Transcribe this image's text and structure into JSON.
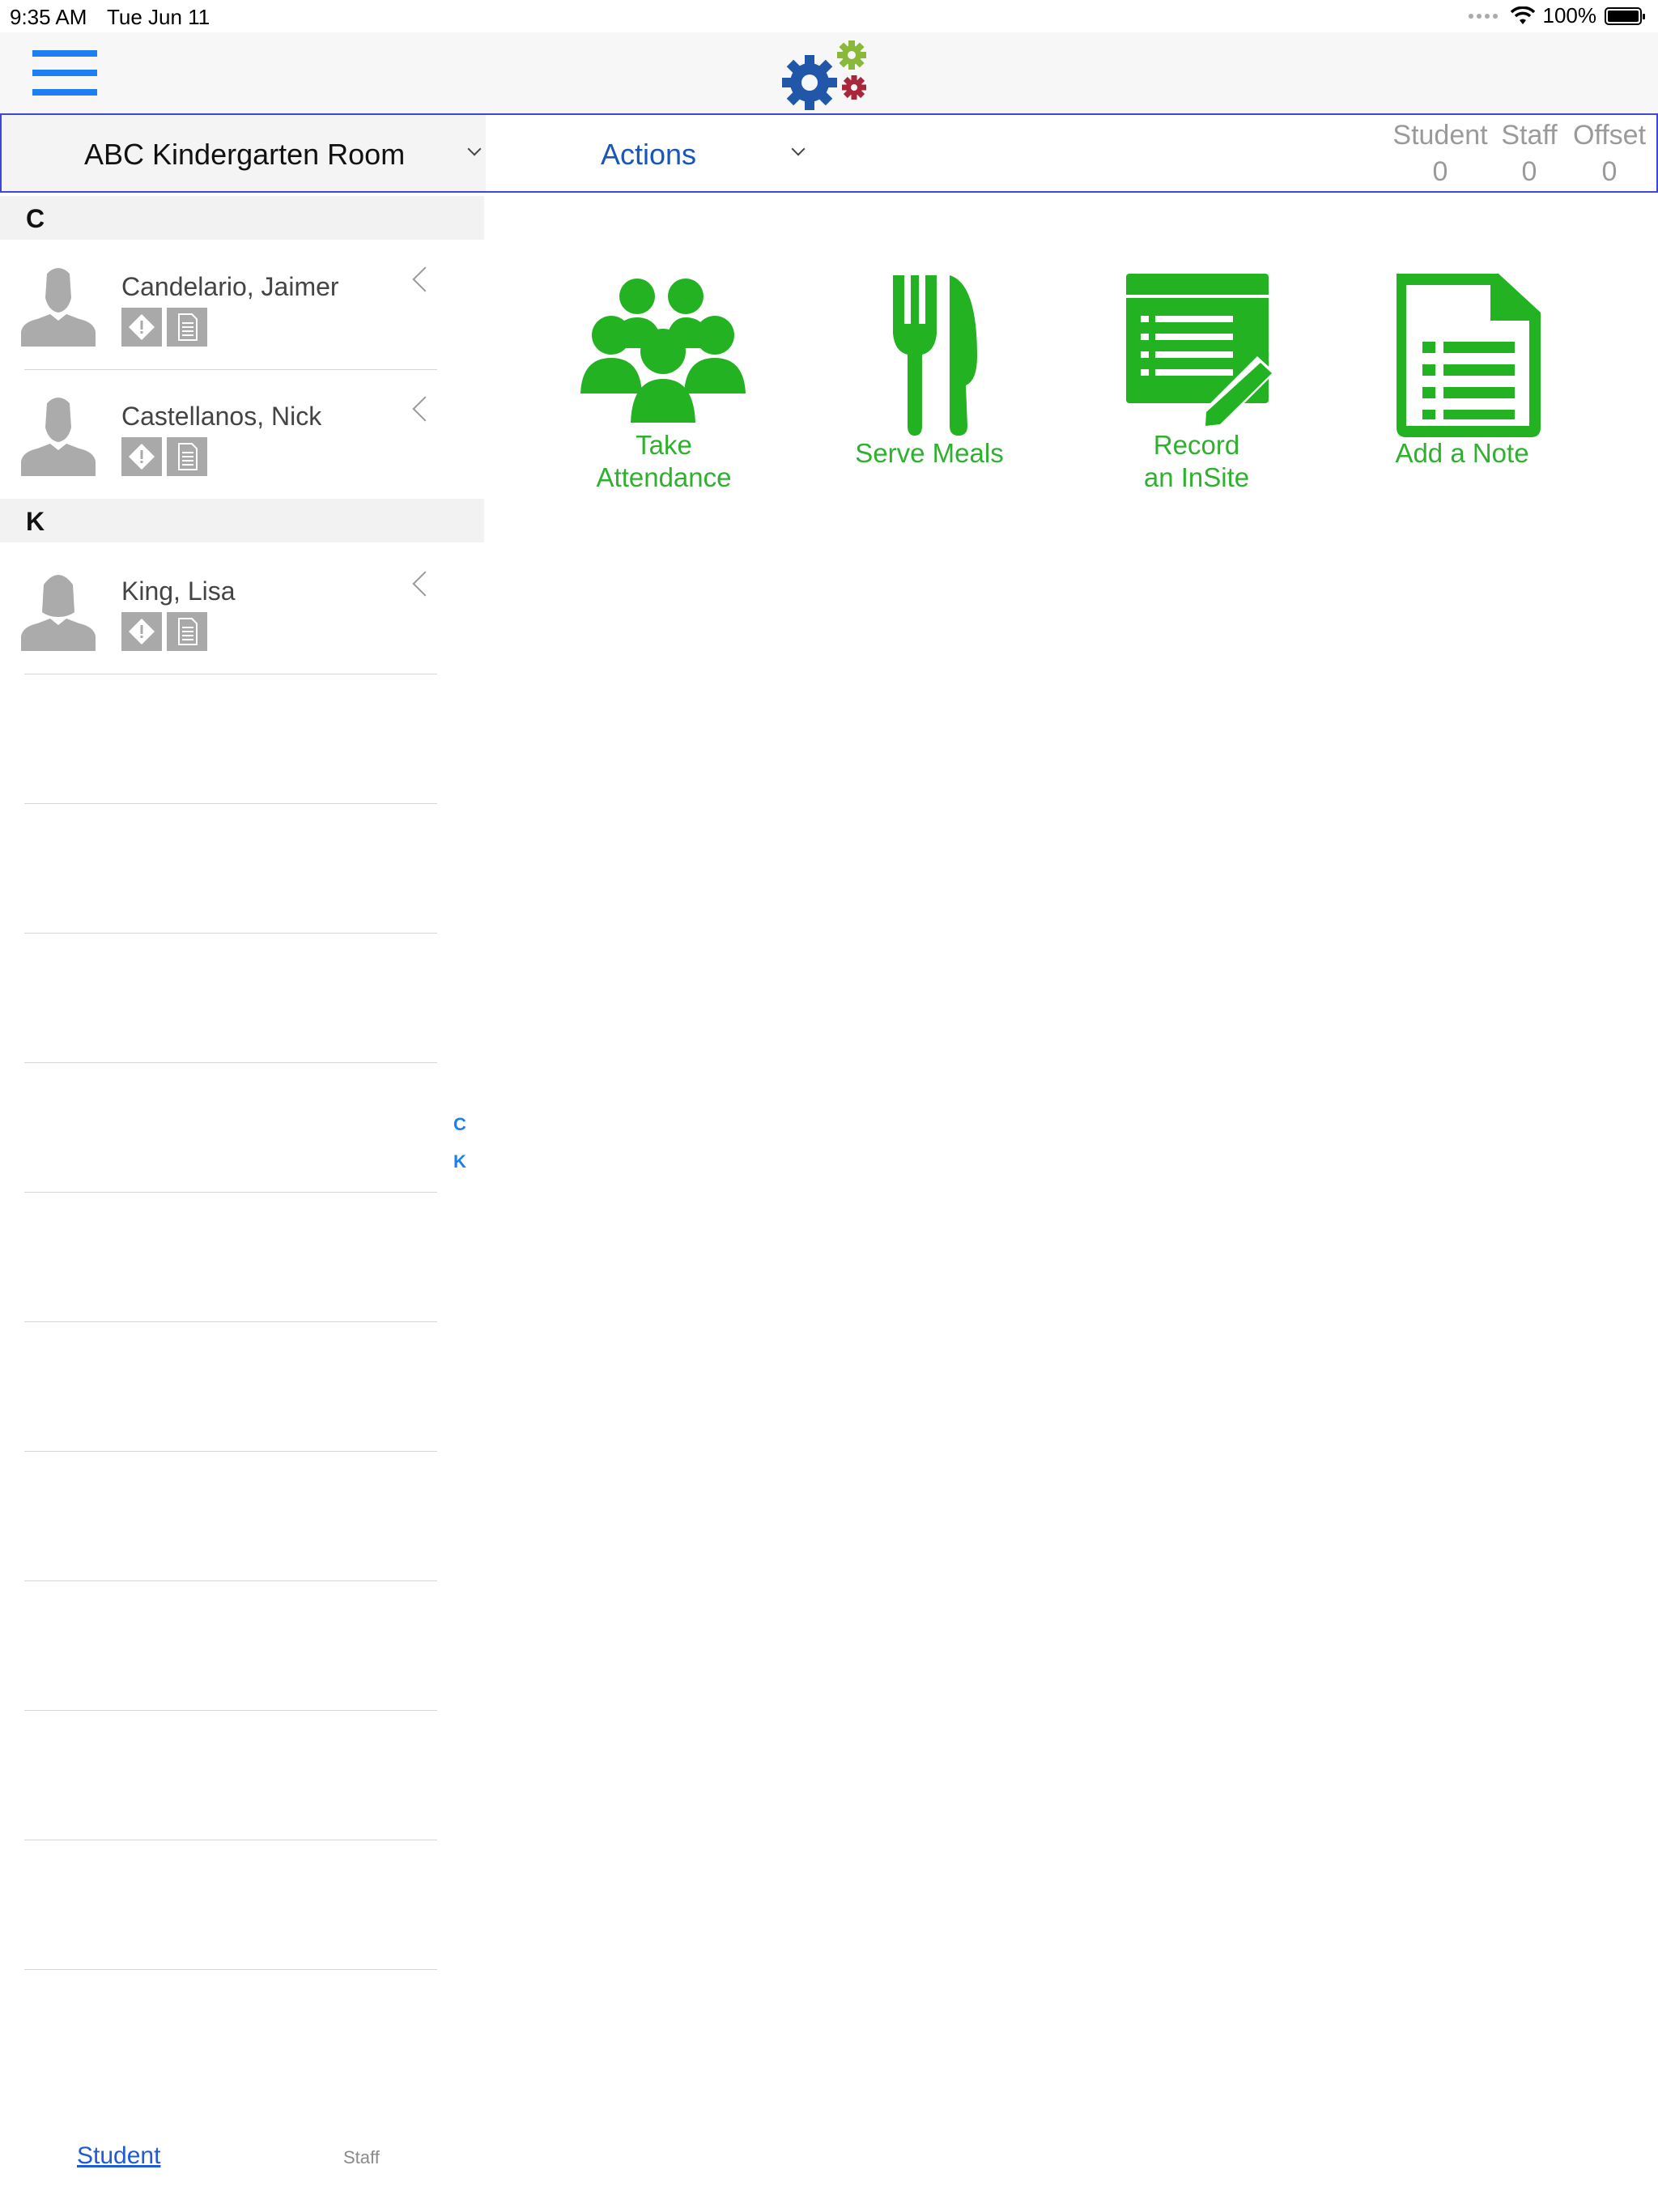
{
  "status_bar": {
    "time": "9:35 AM",
    "date": "Tue Jun 11",
    "battery": "100%"
  },
  "navbar": {
    "menu_icon": "hamburger-menu-icon",
    "logo_icon": "gears-logo-icon"
  },
  "selector": {
    "room": "ABC Kindergarten Room",
    "actions_label": "Actions",
    "counts": [
      {
        "label": "Student",
        "value": "0"
      },
      {
        "label": "Staff",
        "value": "0"
      },
      {
        "label": "Offset",
        "value": "0"
      }
    ]
  },
  "students": {
    "sections": [
      {
        "letter": "C",
        "items": [
          {
            "name": "Candelario, Jaimer"
          },
          {
            "name": "Castellanos, Nick"
          }
        ]
      },
      {
        "letter": "K",
        "items": [
          {
            "name": "King, Lisa"
          }
        ]
      }
    ],
    "index": [
      "C",
      "K"
    ]
  },
  "actions": [
    {
      "label": "Take\nAttendance",
      "icon": "group-attendance-icon"
    },
    {
      "label": "Serve Meals",
      "icon": "fork-knife-icon"
    },
    {
      "label": "Record\nan InSite",
      "icon": "record-insite-icon"
    },
    {
      "label": "Add a Note",
      "icon": "note-document-icon"
    }
  ],
  "tabs": {
    "student": "Student",
    "staff": "Staff"
  },
  "colors": {
    "accent_green": "#22b222",
    "link_blue": "#1f7ef0",
    "border_blue": "#3d47d8"
  }
}
